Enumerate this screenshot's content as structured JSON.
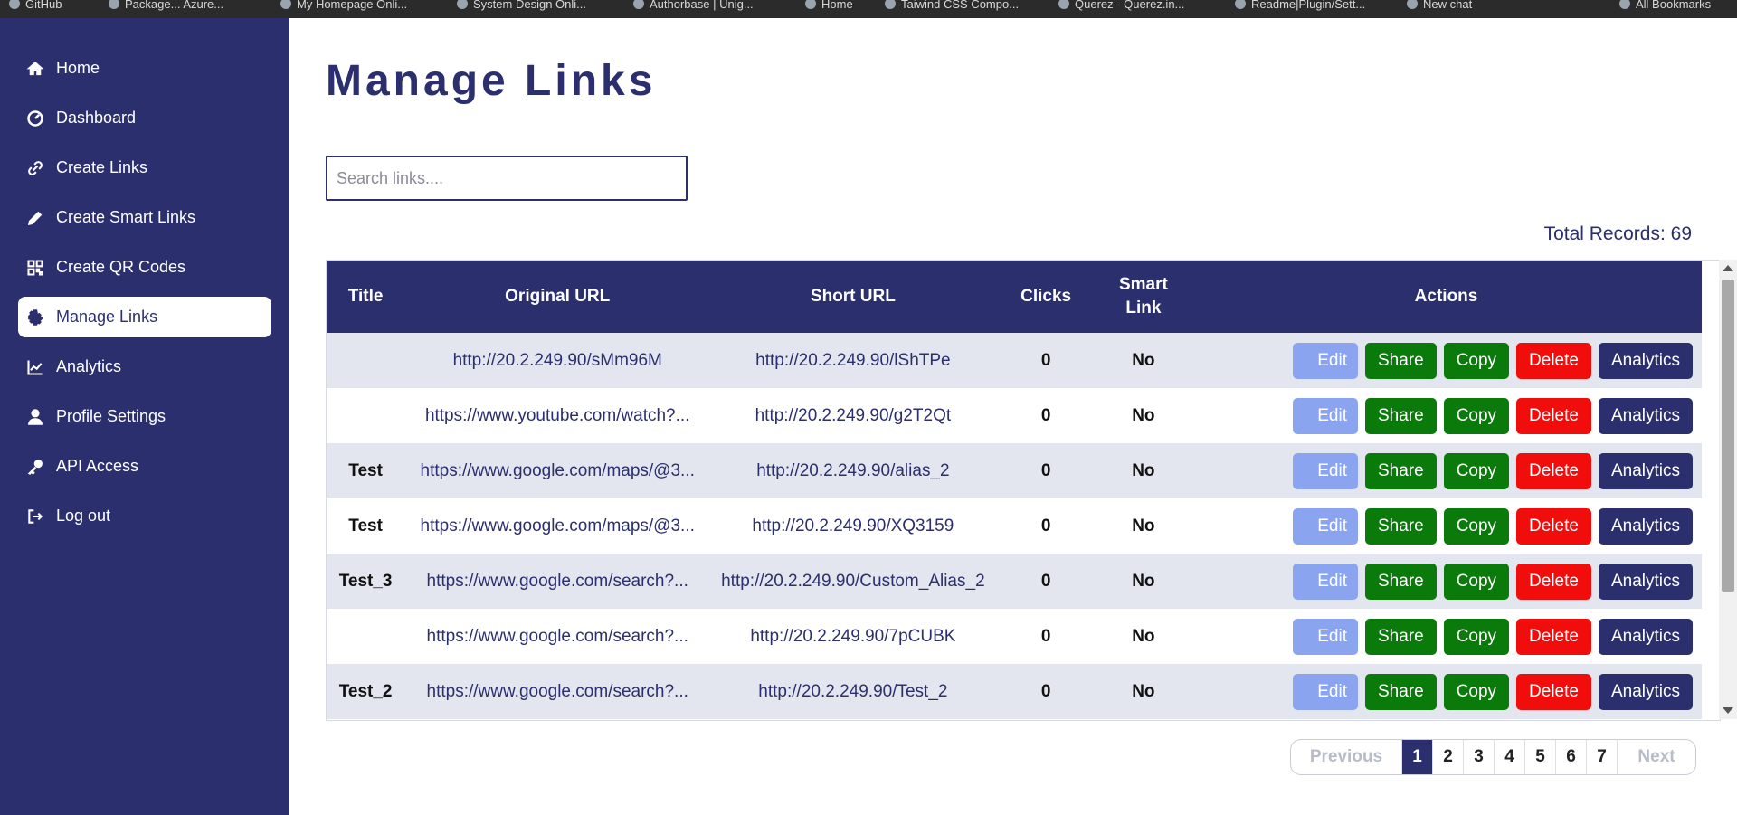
{
  "browser": {
    "bookmarks": [
      "GitHub",
      "Package... Azure...",
      "My Homepage Onli...",
      "System Design Onli...",
      "Authorbase | Unig...",
      "Home",
      "Taiwind CSS Compo...",
      "Querez - Querez.in...",
      "Readme|Plugin/Sett...",
      "New chat",
      "All Bookmarks"
    ]
  },
  "sidebar": {
    "items": [
      {
        "label": "Home",
        "icon": "home-icon"
      },
      {
        "label": "Dashboard",
        "icon": "dashboard-icon"
      },
      {
        "label": "Create Links",
        "icon": "link-icon"
      },
      {
        "label": "Create Smart Links",
        "icon": "pencil-icon"
      },
      {
        "label": "Create QR Codes",
        "icon": "qr-code-icon"
      },
      {
        "label": "Manage Links",
        "icon": "gear-icon"
      },
      {
        "label": "Analytics",
        "icon": "chart-line-icon"
      },
      {
        "label": "Profile Settings",
        "icon": "user-icon"
      },
      {
        "label": "API Access",
        "icon": "key-icon"
      },
      {
        "label": "Log out",
        "icon": "logout-icon"
      }
    ],
    "active": "Manage Links"
  },
  "main": {
    "title": "Manage Links",
    "search": {
      "placeholder": "Search links....",
      "value": ""
    },
    "total_records": "Total Records: 69",
    "table": {
      "headers": {
        "title": "Title",
        "original_url": "Original URL",
        "short_url": "Short URL",
        "clicks": "Clicks",
        "smart_link": "Smart Link",
        "actions": "Actions"
      },
      "action_labels": {
        "edit": "Edit",
        "share": "Share",
        "copy": "Copy",
        "delete": "Delete",
        "analytics": "Analytics"
      },
      "rows": [
        {
          "title": "",
          "original_url": "http://20.2.249.90/sMm96M",
          "short_url": "http://20.2.249.90/lShTPe",
          "clicks": "0",
          "smart": "No"
        },
        {
          "title": "",
          "original_url": "https://www.youtube.com/watch?...",
          "short_url": "http://20.2.249.90/g2T2Qt",
          "clicks": "0",
          "smart": "No"
        },
        {
          "title": "Test",
          "original_url": "https://www.google.com/maps/@3...",
          "short_url": "http://20.2.249.90/alias_2",
          "clicks": "0",
          "smart": "No"
        },
        {
          "title": "Test",
          "original_url": "https://www.google.com/maps/@3...",
          "short_url": "http://20.2.249.90/XQ3159",
          "clicks": "0",
          "smart": "No"
        },
        {
          "title": "Test_3",
          "original_url": "https://www.google.com/search?...",
          "short_url": "http://20.2.249.90/Custom_Alias_2",
          "clicks": "0",
          "smart": "No"
        },
        {
          "title": "",
          "original_url": "https://www.google.com/search?...",
          "short_url": "http://20.2.249.90/7pCUBK",
          "clicks": "0",
          "smart": "No"
        },
        {
          "title": "Test_2",
          "original_url": "https://www.google.com/search?...",
          "short_url": "http://20.2.249.90/Test_2",
          "clicks": "0",
          "smart": "No"
        }
      ]
    },
    "pagination": {
      "previous": "Previous",
      "next": "Next",
      "pages": [
        "1",
        "2",
        "3",
        "4",
        "5",
        "6",
        "7"
      ],
      "current": "1"
    }
  },
  "colors": {
    "primary": "#2c2f6e",
    "edit": "#8aa4f0",
    "share": "#0a7a0a",
    "copy": "#0a7a0a",
    "delete": "#f20d0d",
    "row_alt": "#e3e6ee"
  }
}
